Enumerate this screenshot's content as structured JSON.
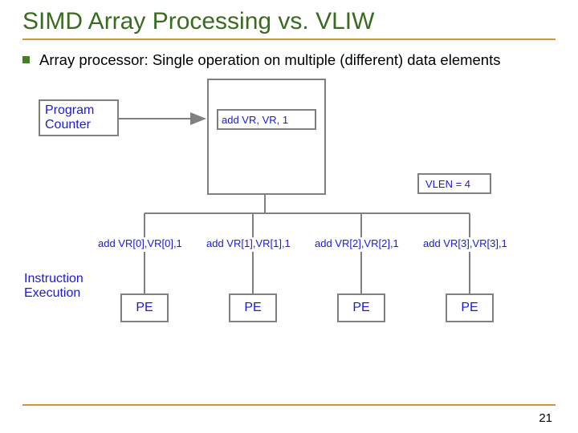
{
  "title": "SIMD Array Processing vs. VLIW",
  "bullet": "Array processor: Single operation on multiple (different) data elements",
  "diagram": {
    "program_counter": "Program\nCounter",
    "instr_add": "add  VR, VR, 1",
    "vlen": "VLEN = 4",
    "instr_exec": "Instruction\nExecution",
    "pe_ops": [
      "add VR[0],VR[0],1",
      "add VR[1],VR[1],1",
      "add VR[2],VR[2],1",
      "add VR[3],VR[3],1"
    ],
    "pe_label": "PE"
  },
  "page": "21"
}
